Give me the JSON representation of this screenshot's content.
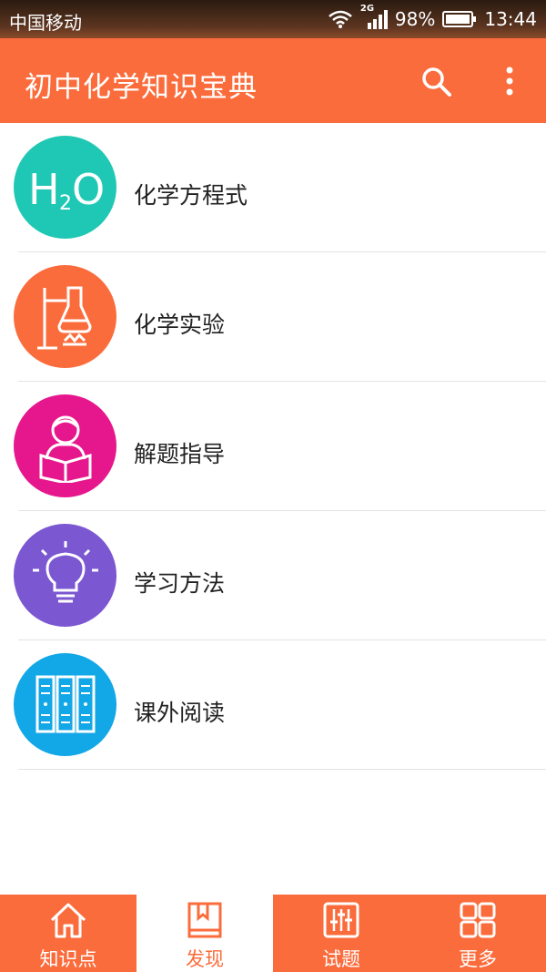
{
  "status_bar": {
    "carrier": "中国移动",
    "network": "2G",
    "battery": "98%",
    "time": "13:44"
  },
  "app_bar": {
    "title": "初中化学知识宝典",
    "icons": [
      "search-icon",
      "more-vert-icon"
    ]
  },
  "menu_items": [
    {
      "label": "化学方程式",
      "icon": "h2o-icon",
      "color": "#1fc8b4"
    },
    {
      "label": "化学实验",
      "icon": "lab-flask-icon",
      "color": "#fb6c3c"
    },
    {
      "label": "解题指导",
      "icon": "reader-icon",
      "color": "#e6178d"
    },
    {
      "label": "学习方法",
      "icon": "lightbulb-icon",
      "color": "#7b57d1"
    },
    {
      "label": "课外阅读",
      "icon": "bookshelf-icon",
      "color": "#12a7e6"
    }
  ],
  "icon_text": {
    "h2o_main": "H",
    "h2o_sub": "2",
    "h2o_end": "O"
  },
  "tabs": [
    {
      "label": "知识点",
      "icon": "home-icon",
      "active": false
    },
    {
      "label": "发现",
      "icon": "book-icon",
      "active": true
    },
    {
      "label": "试题",
      "icon": "sliders-icon",
      "active": false
    },
    {
      "label": "更多",
      "icon": "grid-icon",
      "active": false
    }
  ],
  "colors": {
    "accent": "#fb6c3c",
    "divider": "#e3e3e3"
  }
}
